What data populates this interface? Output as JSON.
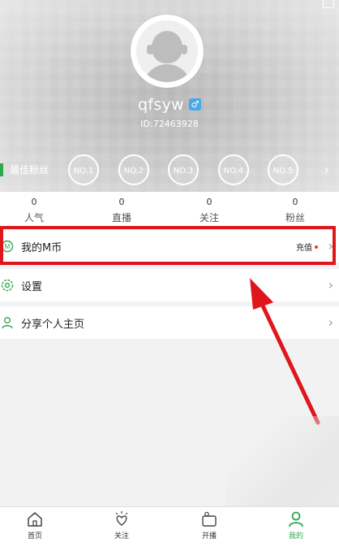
{
  "profile": {
    "username": "qfsyw",
    "gender_symbol": "♂",
    "user_id": "ID:72463928"
  },
  "fans": {
    "label": "最佳粉丝",
    "ranks": [
      "NO.1",
      "NO.2",
      "NO.3",
      "NO.4",
      "NO.5"
    ],
    "more_symbol": "›"
  },
  "stats": [
    {
      "value": "0",
      "label": "人气"
    },
    {
      "value": "0",
      "label": "直播"
    },
    {
      "value": "0",
      "label": "关注"
    },
    {
      "value": "0",
      "label": "粉丝"
    }
  ],
  "menu": {
    "coins_label": "我的M币",
    "coins_icon_letter": "M",
    "recharge_label": "充值",
    "settings_label": "设置",
    "share_label": "分享个人主页",
    "chevron": "›"
  },
  "nav": {
    "items": [
      {
        "label": "首页"
      },
      {
        "label": "关注"
      },
      {
        "label": "开播"
      },
      {
        "label": "我的"
      }
    ],
    "active_index": 3
  },
  "colors": {
    "accent": "#2fa84f",
    "highlight": "#e0161d",
    "gender": "#48a8e8"
  }
}
